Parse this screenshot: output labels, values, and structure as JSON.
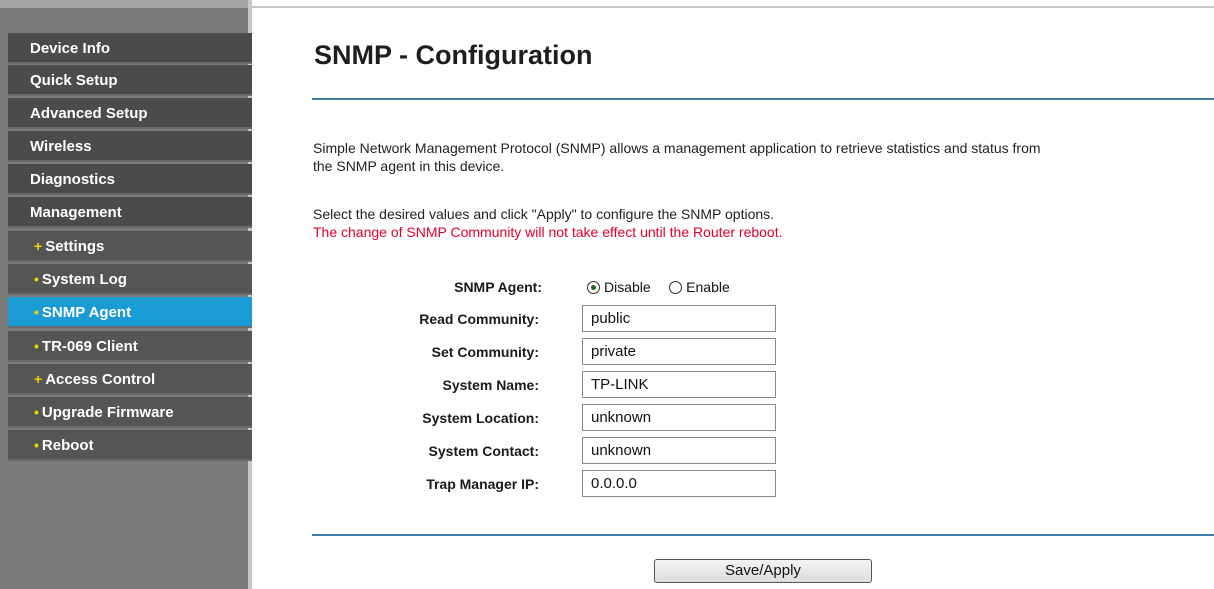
{
  "sidebar": {
    "items": [
      {
        "label": "Device Info"
      },
      {
        "label": "Quick Setup"
      },
      {
        "label": "Advanced Setup"
      },
      {
        "label": "Wireless"
      },
      {
        "label": "Diagnostics"
      },
      {
        "label": "Management"
      },
      {
        "label": "Settings",
        "bullet": "+"
      },
      {
        "label": "System Log",
        "bullet": "•"
      },
      {
        "label": "SNMP Agent",
        "bullet": "•"
      },
      {
        "label": "TR-069 Client",
        "bullet": "•"
      },
      {
        "label": "Access Control",
        "bullet": "+"
      },
      {
        "label": "Upgrade Firmware",
        "bullet": "•"
      },
      {
        "label": "Reboot",
        "bullet": "•"
      }
    ],
    "active_item": "SNMP Agent"
  },
  "main": {
    "title": "SNMP - Configuration",
    "description_1": "Simple Network Management Protocol (SNMP) allows a management application to retrieve statistics and status from",
    "description_2": "the SNMP agent in this device.",
    "instruction": "Select the desired values and click \"Apply\" to configure the SNMP options.",
    "warning": "The change of SNMP Community will not take effect until the Router reboot."
  },
  "form": {
    "agent_label": "SNMP Agent:",
    "agent_options": [
      {
        "label": "Disable",
        "checked": true
      },
      {
        "label": "Enable",
        "checked": false
      }
    ],
    "read_community_label": "Read Community:",
    "read_community_value": "public",
    "set_community_label": "Set Community:",
    "set_community_value": "private",
    "system_name_label": "System Name:",
    "system_name_value": "TP-LINK",
    "system_location_label": "System Location:",
    "system_location_value": "unknown",
    "system_contact_label": "System Contact:",
    "system_contact_value": "unknown",
    "trap_manager_label": "Trap Manager IP:",
    "trap_manager_value": "0.0.0.0"
  },
  "buttons": {
    "save_apply": "Save/Apply"
  },
  "colors": {
    "sidebar_bg": "#7a7a7a",
    "nav_item_bg": "#4b4b4b",
    "active_bg": "#1b9ad4",
    "rule": "#3d7ea6",
    "warning_text": "#e4002b",
    "bullet": "#f2d300"
  }
}
